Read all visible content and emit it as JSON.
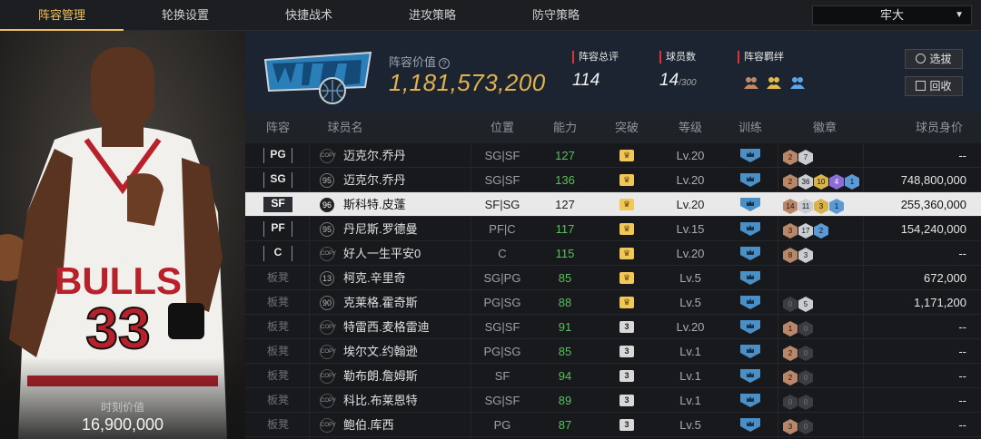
{
  "tabs": [
    "阵容管理",
    "轮换设置",
    "快捷战术",
    "进攻策略",
    "防守策略"
  ],
  "owner": {
    "selected": "牢大"
  },
  "left_panel": {
    "moment_label": "时刻价值",
    "moment_value": "16,900,000"
  },
  "header": {
    "value_label": "阵容价值",
    "value": "1,181,573,200",
    "overall_label": "阵容总评",
    "overall": "114",
    "count_label": "球员数",
    "count": "14",
    "count_max": "/300",
    "chem_label": "阵容羁绊",
    "btn_pick": "选拔",
    "btn_recycle": "回收"
  },
  "columns": [
    "阵容",
    "球员名",
    "位置",
    "能力",
    "突破",
    "等级",
    "训练",
    "徽章",
    "球员身价"
  ],
  "accent": "#f0c15a",
  "rows": [
    {
      "slot": "PG",
      "bench": false,
      "rating": "COPY",
      "name": "迈克尔.乔丹",
      "pos": "SG|SF",
      "ability": "127",
      "break": "crown",
      "level": "Lv.20",
      "badges": [
        [
          "bronze",
          "2"
        ],
        [
          "silver",
          "7"
        ]
      ],
      "value": "--"
    },
    {
      "slot": "SG",
      "bench": false,
      "rating": "95",
      "name": "迈克尔.乔丹",
      "pos": "SG|SF",
      "ability": "136",
      "break": "crown",
      "level": "Lv.20",
      "badges": [
        [
          "bronze",
          "2"
        ],
        [
          "silver",
          "36"
        ],
        [
          "gold",
          "10"
        ],
        [
          "purple",
          "4"
        ],
        [
          "blue",
          "1"
        ]
      ],
      "value": "748,800,000"
    },
    {
      "slot": "SF",
      "bench": false,
      "rating": "96",
      "name": "斯科特.皮蓬",
      "pos": "SF|SG",
      "ability": "127",
      "break": "crown",
      "level": "Lv.20",
      "badges": [
        [
          "bronze",
          "14"
        ],
        [
          "silver",
          "11"
        ],
        [
          "gold",
          "3"
        ],
        [
          "blue",
          "1"
        ]
      ],
      "value": "255,360,000",
      "selected": true
    },
    {
      "slot": "PF",
      "bench": false,
      "rating": "95",
      "name": "丹尼斯.罗德曼",
      "pos": "PF|C",
      "ability": "117",
      "break": "crown",
      "level": "Lv.15",
      "badges": [
        [
          "bronze",
          "3"
        ],
        [
          "silver",
          "17"
        ],
        [
          "blue",
          "2"
        ]
      ],
      "value": "154,240,000"
    },
    {
      "slot": "C",
      "bench": false,
      "rating": "COPY",
      "name": "好人一生平安0",
      "pos": "C",
      "ability": "115",
      "break": "crown",
      "level": "Lv.20",
      "badges": [
        [
          "bronze",
          "8"
        ],
        [
          "silver",
          "3"
        ]
      ],
      "value": "--"
    },
    {
      "slot": "板凳",
      "bench": true,
      "rating": "13",
      "name": "柯克.辛里奇",
      "pos": "SG|PG",
      "ability": "85",
      "break": "crown",
      "level": "Lv.5",
      "badges": [],
      "value": "672,000"
    },
    {
      "slot": "板凳",
      "bench": true,
      "rating": "90",
      "name": "克莱格.霍奇斯",
      "pos": "PG|SG",
      "ability": "88",
      "break": "crown",
      "level": "Lv.5",
      "badges": [
        [
          "dim",
          "0"
        ],
        [
          "silver",
          "5"
        ]
      ],
      "value": "1,171,200"
    },
    {
      "slot": "板凳",
      "bench": true,
      "rating": "COPY",
      "name": "特雷西.麦格雷迪",
      "pos": "SG|SF",
      "ability": "91",
      "break": "3",
      "level": "Lv.20",
      "badges": [
        [
          "bronze",
          "1"
        ],
        [
          "dim",
          "0"
        ]
      ],
      "value": "--"
    },
    {
      "slot": "板凳",
      "bench": true,
      "rating": "COPY",
      "name": "埃尔文.约翰逊",
      "pos": "PG|SG",
      "ability": "85",
      "break": "3",
      "level": "Lv.1",
      "badges": [
        [
          "bronze",
          "2"
        ],
        [
          "dim",
          "0"
        ]
      ],
      "value": "--"
    },
    {
      "slot": "板凳",
      "bench": true,
      "rating": "COPY",
      "name": "勒布朗.詹姆斯",
      "pos": "SF",
      "ability": "94",
      "break": "3",
      "level": "Lv.1",
      "badges": [
        [
          "bronze",
          "2"
        ],
        [
          "dim",
          "0"
        ]
      ],
      "value": "--"
    },
    {
      "slot": "板凳",
      "bench": true,
      "rating": "COPY",
      "name": "科比.布莱恩特",
      "pos": "SG|SF",
      "ability": "89",
      "break": "3",
      "level": "Lv.1",
      "badges": [
        [
          "dim",
          "0"
        ],
        [
          "dim",
          "0"
        ]
      ],
      "value": "--"
    },
    {
      "slot": "板凳",
      "bench": true,
      "rating": "COPY",
      "name": "鲍伯.库西",
      "pos": "PG",
      "ability": "87",
      "break": "3",
      "level": "Lv.5",
      "badges": [
        [
          "bronze",
          "3"
        ],
        [
          "dim",
          "0"
        ]
      ],
      "value": "--"
    }
  ]
}
